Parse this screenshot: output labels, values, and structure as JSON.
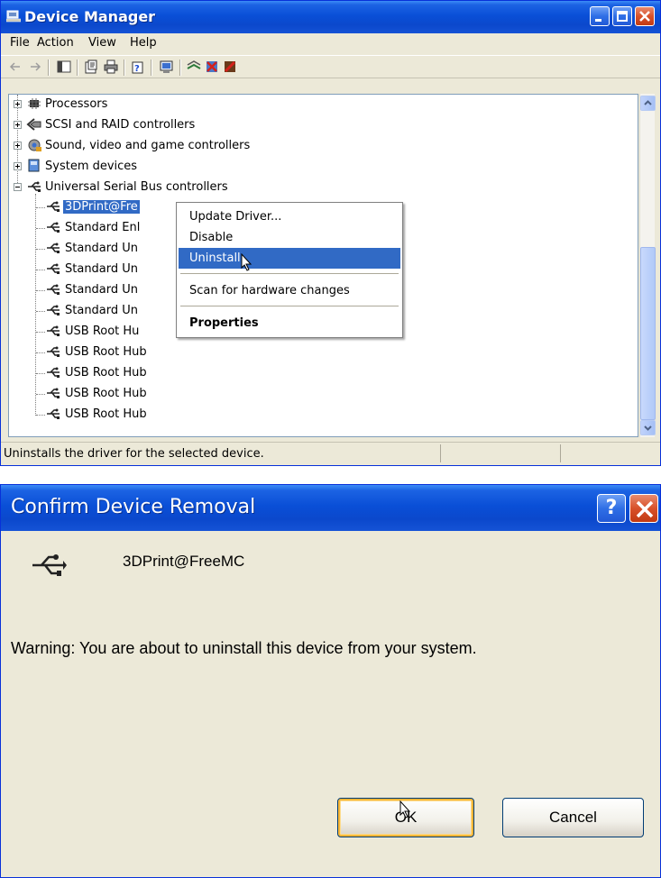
{
  "device_manager": {
    "title": "Device Manager",
    "menu": [
      "File",
      "Action",
      "View",
      "Help"
    ],
    "toolbar_icons": [
      "back-arrow-icon",
      "forward-arrow-icon",
      "console-tree-icon",
      "properties-icon",
      "print-icon",
      "help-icon",
      "update-driver-icon",
      "uninstall-icon",
      "disable-icon",
      "scan-hardware-icon"
    ],
    "tree": [
      {
        "label": "Processors",
        "icon": "processor-icon",
        "expander": "plus"
      },
      {
        "label": "SCSI and RAID controllers",
        "icon": "scsi-icon",
        "expander": "plus"
      },
      {
        "label": "Sound, video and game controllers",
        "icon": "sound-icon",
        "expander": "plus"
      },
      {
        "label": "System devices",
        "icon": "system-device-icon",
        "expander": "plus"
      },
      {
        "label": "Universal Serial Bus controllers",
        "icon": "usb-icon",
        "expander": "minus"
      }
    ],
    "usb_children": [
      "3DPrint@Fre",
      "Standard Enl",
      "Standard Un",
      "Standard Un",
      "Standard Un",
      "Standard Un",
      "USB Root Hu",
      "USB Root Hub",
      "USB Root Hub",
      "USB Root Hub",
      "USB Root Hub"
    ],
    "context_menu": {
      "update_driver": "Update Driver...",
      "disable": "Disable",
      "uninstall": "Uninstall",
      "scan": "Scan for hardware changes",
      "properties": "Properties"
    },
    "status_text": "Uninstalls the driver for the selected device."
  },
  "confirm_dialog": {
    "title": "Confirm Device Removal",
    "help_label": "?",
    "device_name": "3DPrint@FreeMC",
    "warning": "Warning: You are about to uninstall this device from your system.",
    "ok_label": "OK",
    "cancel_label": "Cancel"
  },
  "colors": {
    "titlebar": "#0a4fd7",
    "selection": "#316ac5",
    "window_bg": "#ece9d8",
    "close_button": "#d8512a"
  }
}
